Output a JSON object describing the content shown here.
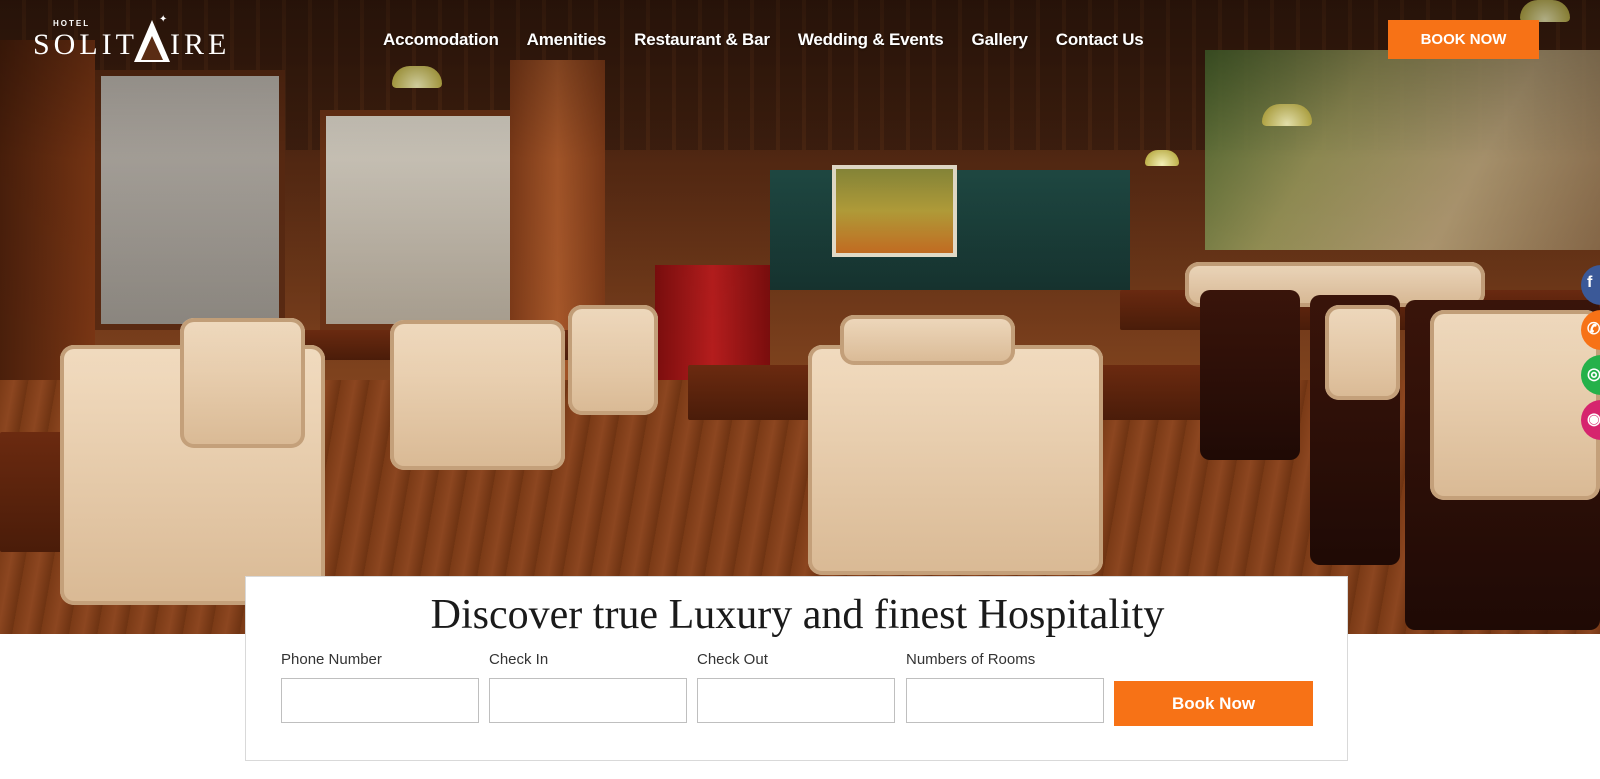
{
  "brand": {
    "small": "HOTEL",
    "name_left": "SOLIT",
    "name_right": "IRE"
  },
  "nav": {
    "items": [
      "Accomodation",
      "Amenities",
      "Restaurant & Bar",
      "Wedding & Events",
      "Gallery",
      "Contact Us"
    ]
  },
  "header": {
    "book_label": "BOOK NOW"
  },
  "social": {
    "icons": [
      "facebook-icon",
      "phone-icon",
      "whatsapp-icon",
      "instagram-icon"
    ]
  },
  "booking": {
    "headline": "Discover true Luxury and finest Hospitality",
    "fields": {
      "phone": {
        "label": "Phone Number",
        "value": ""
      },
      "check_in": {
        "label": "Check In",
        "value": ""
      },
      "check_out": {
        "label": "Check Out",
        "value": ""
      },
      "rooms": {
        "label": "Numbers of Rooms",
        "value": ""
      }
    },
    "submit_label": "Book Now"
  },
  "colors": {
    "accent": "#f77216",
    "facebook": "#3b5998",
    "whatsapp": "#25b14a",
    "instagram": "#d6246e"
  }
}
